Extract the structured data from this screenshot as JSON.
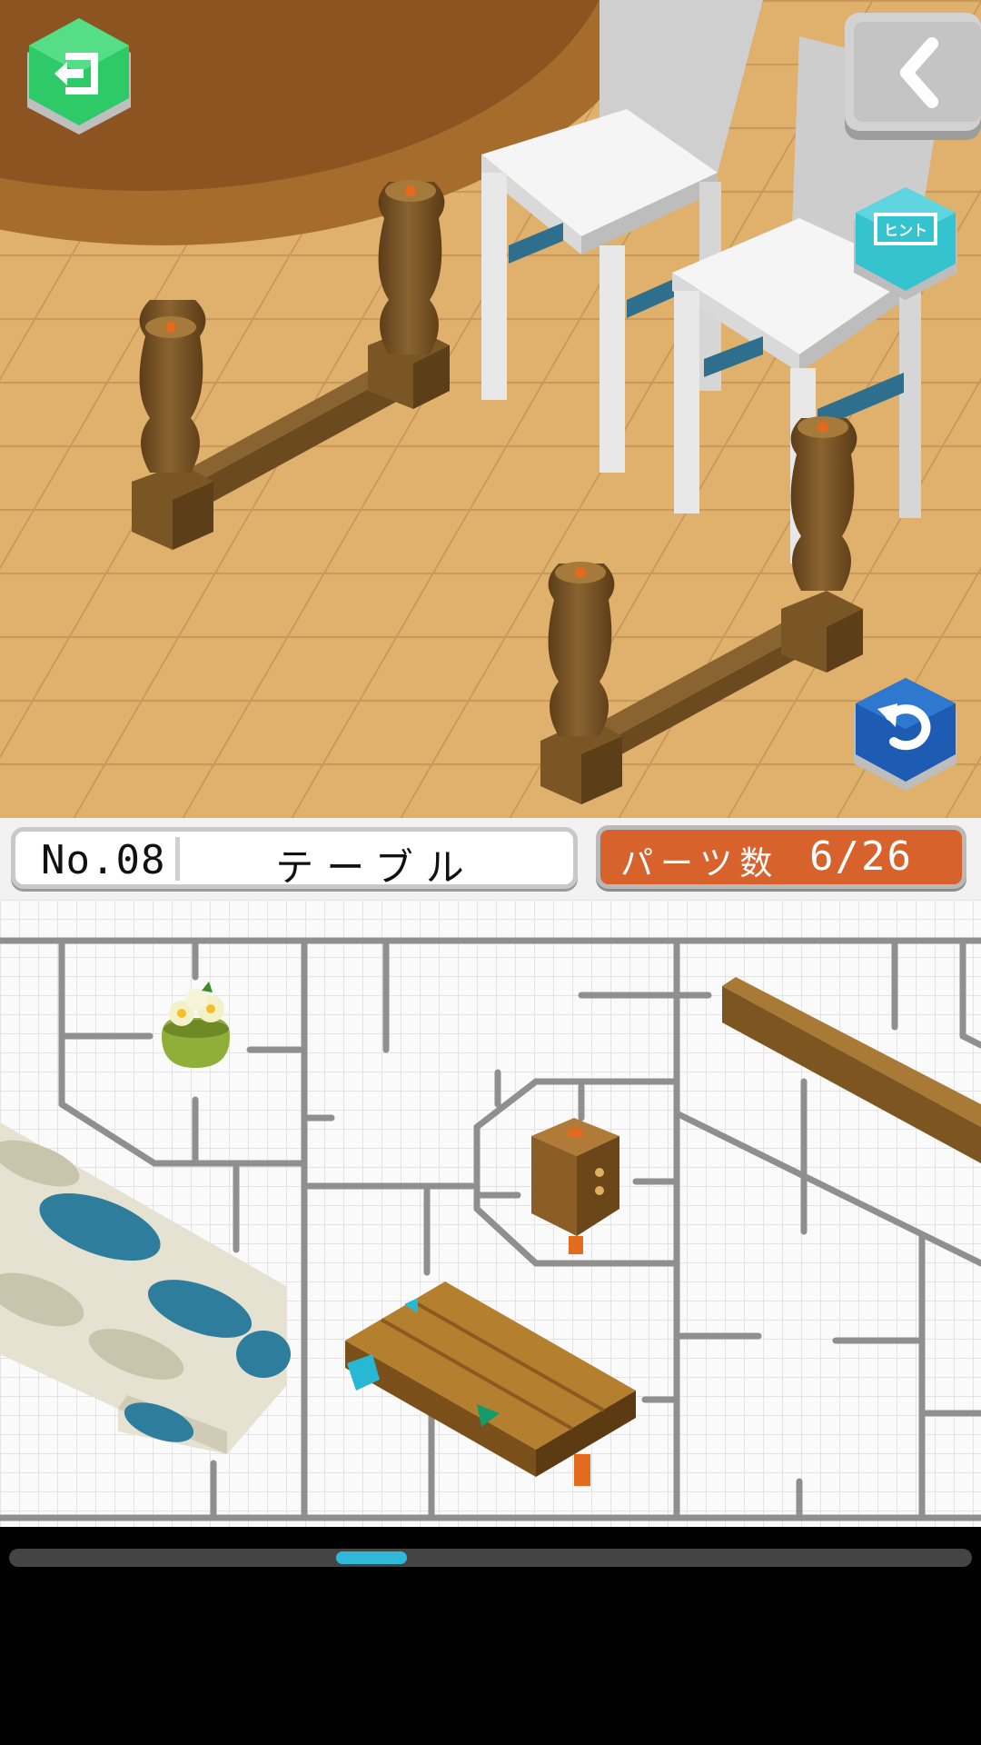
{
  "game": {
    "level_number": "No.08",
    "level_name": "テーブル",
    "parts_label": "パーツ数",
    "parts_count": "6/26",
    "parts_placed": 6,
    "parts_total": 26
  },
  "buttons": {
    "exit_icon": "exit-door-icon",
    "back_icon": "chevron-left-icon",
    "hint_text": "ヒント",
    "rotate_icon": "rotate-arrow-icon"
  },
  "maze_parts": [
    "flower-pot",
    "tablecloth",
    "wooden-connector-block",
    "table-top-plank",
    "long-wooden-rail"
  ],
  "colors": {
    "exit_button": "#2fca68",
    "hint_button": "#35c3cf",
    "rotate_button": "#1e5bb3",
    "parts_panel": "#d8622c",
    "scroll_thumb": "#2fb8d8"
  }
}
